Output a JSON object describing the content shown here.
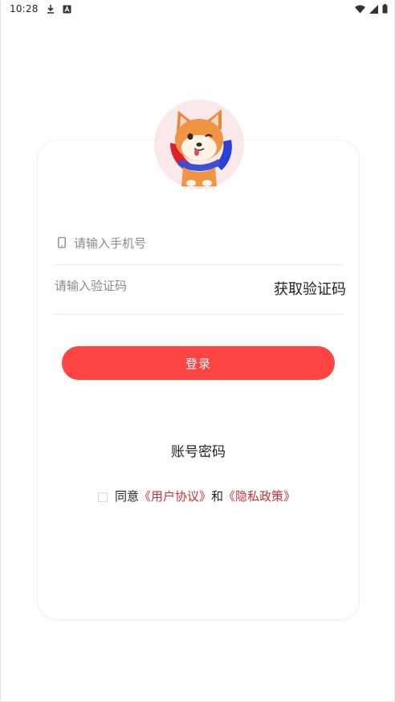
{
  "status_bar": {
    "time": "10:28",
    "icons": [
      "download-icon",
      "a-box-icon",
      "wifi-icon",
      "signal-icon",
      "battery-icon"
    ]
  },
  "login": {
    "phone_placeholder": "请输入手机号",
    "code_placeholder": "请输入验证码",
    "get_code_label": "获取验证码",
    "login_button": "登录",
    "account_password_link": "账号密码"
  },
  "agreement": {
    "prefix": "同意",
    "user_agreement": "《用户协议》",
    "conjunction": "和",
    "privacy_policy": "《隐私政策》"
  },
  "colors": {
    "accent": "#ff4444",
    "link": "#c8303a"
  }
}
